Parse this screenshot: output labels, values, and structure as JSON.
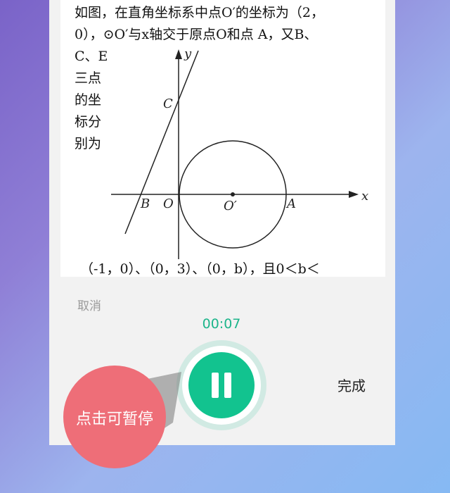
{
  "question": {
    "lines": [
      "如图，在直角坐标系中点O′的坐标为（2，",
      "0），⊙O′与x轴交于原点O和点 A，又B、",
      "C、E",
      "三点",
      "的坐",
      "标分",
      "别为"
    ],
    "bottom_line": "（-1，0）、（0，3）、（0，b），且0＜b＜",
    "figure_labels": {
      "y_axis": "y",
      "x_axis": "x",
      "point_c": "C",
      "point_b": "B",
      "origin": "O",
      "center": "O′",
      "point_a": "A"
    }
  },
  "recorder": {
    "cancel_label": "取消",
    "timer": "00:07",
    "done_label": "完成",
    "tip": "点击可暂停",
    "accent_color": "#12c38f",
    "tip_color": "#ee6e78",
    "button_icon": "pause-icon"
  }
}
